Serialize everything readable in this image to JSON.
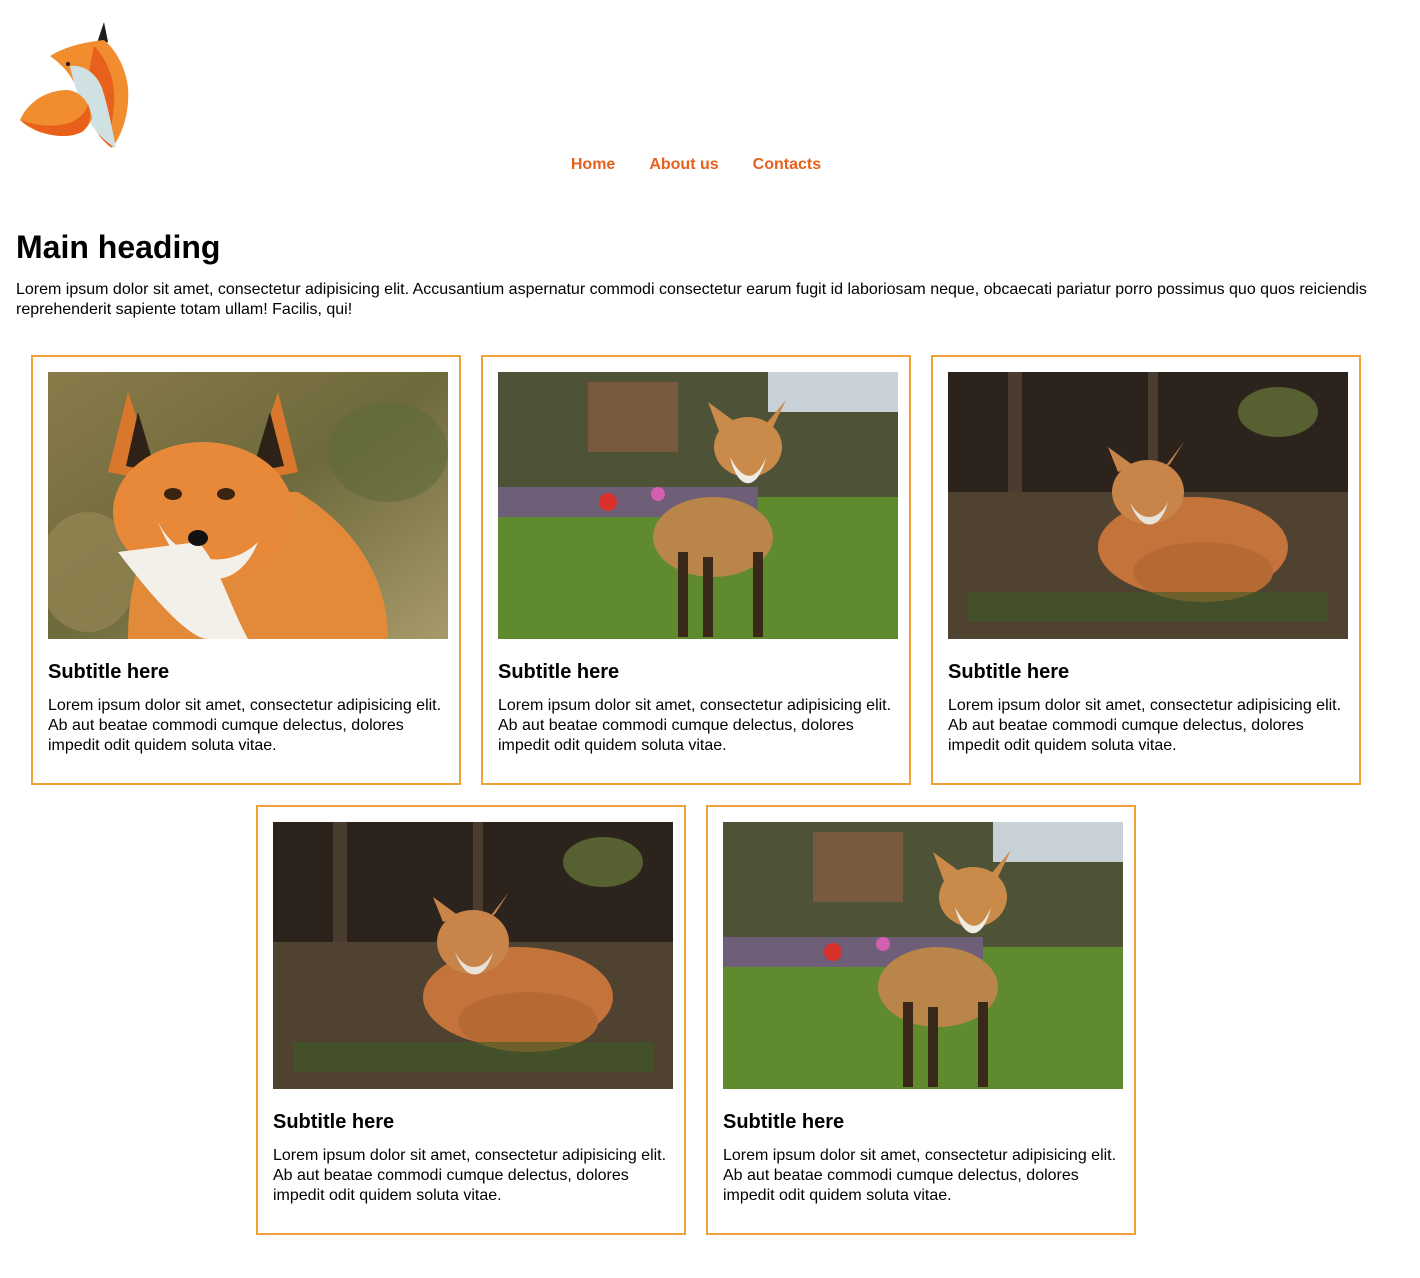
{
  "nav": {
    "items": [
      {
        "label": "Home"
      },
      {
        "label": "About us"
      },
      {
        "label": "Contacts"
      }
    ]
  },
  "main": {
    "heading": "Main heading",
    "intro": "Lorem ipsum dolor sit amet, consectetur adipisicing elit. Accusantium aspernatur commodi consectetur earum fugit id laboriosam neque, obcaecati pariatur porro possimus quo quos reiciendis reprehenderit sapiente totam ullam! Facilis, qui!"
  },
  "cards": [
    {
      "image": "fox-portrait",
      "title": "Subtitle here",
      "text": "Lorem ipsum dolor sit amet, consectetur adipisicing elit. Ab aut beatae commodi cumque delectus, dolores impedit odit quidem soluta vitae."
    },
    {
      "image": "fox-garden",
      "title": "Subtitle here",
      "text": "Lorem ipsum dolor sit amet, consectetur adipisicing elit. Ab aut beatae commodi cumque delectus, dolores impedit odit quidem soluta vitae."
    },
    {
      "image": "fox-lying",
      "title": "Subtitle here",
      "text": "Lorem ipsum dolor sit amet, consectetur adipisicing elit. Ab aut beatae commodi cumque delectus, dolores impedit odit quidem soluta vitae."
    },
    {
      "image": "fox-lying",
      "title": "Subtitle here",
      "text": "Lorem ipsum dolor sit amet, consectetur adipisicing elit. Ab aut beatae commodi cumque delectus, dolores impedit odit quidem soluta vitae."
    },
    {
      "image": "fox-garden",
      "title": "Subtitle here",
      "text": "Lorem ipsum dolor sit amet, consectetur adipisicing elit. Ab aut beatae commodi cumque delectus, dolores impedit odit quidem soluta vitae."
    }
  ],
  "colors": {
    "nav_link": "#e8601c",
    "card_border": "#f0a238"
  }
}
